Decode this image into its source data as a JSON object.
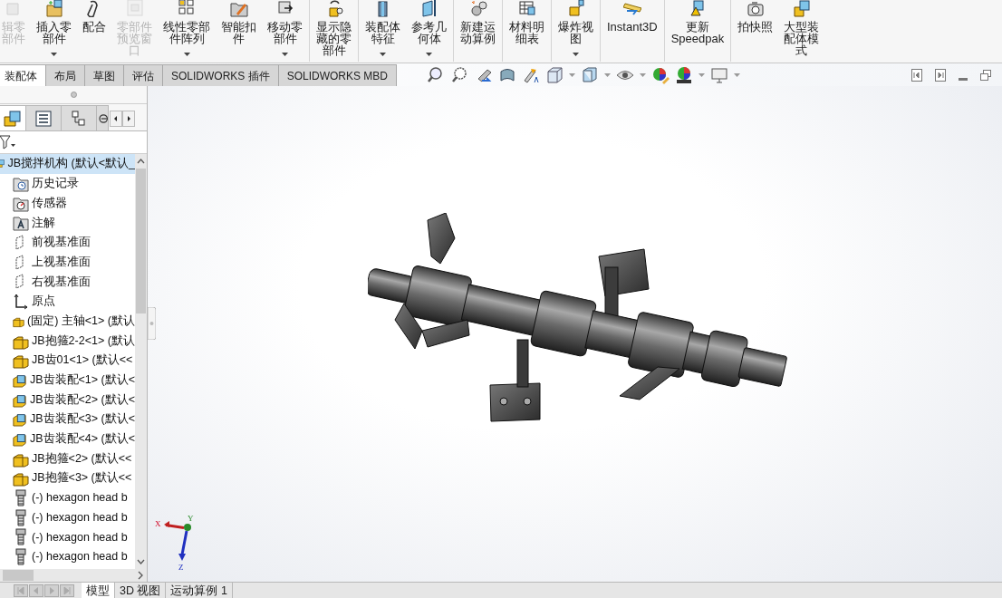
{
  "toolbar": {
    "buttons": [
      {
        "lines": [
          "辑零",
          "部件"
        ],
        "disabled": true,
        "dropdown": false
      },
      {
        "lines": [
          "插入零",
          "部件"
        ],
        "disabled": false,
        "dropdown": true
      },
      {
        "lines": [
          "配合"
        ],
        "disabled": false,
        "dropdown": false
      },
      {
        "lines": [
          "零部件",
          "预览窗",
          "口"
        ],
        "disabled": true,
        "dropdown": false
      },
      {
        "lines": [
          "线性零部",
          "件阵列"
        ],
        "disabled": false,
        "dropdown": true
      },
      {
        "lines": [
          "智能扣",
          "件"
        ],
        "disabled": false,
        "dropdown": false
      },
      {
        "lines": [
          "移动零",
          "部件"
        ],
        "disabled": false,
        "dropdown": true
      },
      {
        "lines": [
          "显示隐",
          "藏的零",
          "部件"
        ],
        "disabled": false,
        "dropdown": false
      },
      {
        "lines": [
          "装配体",
          "特征"
        ],
        "disabled": false,
        "dropdown": true
      },
      {
        "lines": [
          "参考几",
          "何体"
        ],
        "disabled": false,
        "dropdown": true
      },
      {
        "lines": [
          "新建运",
          "动算例"
        ],
        "disabled": false,
        "dropdown": false
      },
      {
        "lines": [
          "材料明",
          "细表"
        ],
        "disabled": false,
        "dropdown": false
      },
      {
        "lines": [
          "爆炸视",
          "图"
        ],
        "disabled": false,
        "dropdown": true
      },
      {
        "lines": [
          "Instant3D"
        ],
        "disabled": false,
        "dropdown": false
      },
      {
        "lines": [
          "更新",
          "Speedpak"
        ],
        "disabled": false,
        "dropdown": false
      },
      {
        "lines": [
          "拍快照"
        ],
        "disabled": false,
        "dropdown": false
      },
      {
        "lines": [
          "大型装",
          "配体模",
          "式"
        ],
        "disabled": false,
        "dropdown": false
      }
    ]
  },
  "command_tabs": [
    {
      "label": "装配体",
      "selected": true
    },
    {
      "label": "布局",
      "selected": false
    },
    {
      "label": "草图",
      "selected": false
    },
    {
      "label": "评估",
      "selected": false
    },
    {
      "label": "SOLIDWORKS 插件",
      "selected": false
    },
    {
      "label": "SOLIDWORKS MBD",
      "selected": false
    }
  ],
  "feature_tree": {
    "root": {
      "label": "JB搅拌机构 (默认<默认_",
      "selected": true,
      "children": [
        {
          "kind": "history",
          "label": "历史记录",
          "selected": false
        },
        {
          "kind": "sensor",
          "label": "传感器",
          "selected": false
        },
        {
          "kind": "annotation",
          "label": "注解",
          "selected": false
        },
        {
          "kind": "plane",
          "label": "前视基准面",
          "selected": false
        },
        {
          "kind": "plane",
          "label": "上视基准面",
          "selected": false
        },
        {
          "kind": "plane",
          "label": "右视基准面",
          "selected": false
        },
        {
          "kind": "origin",
          "label": "原点",
          "selected": false
        },
        {
          "kind": "part",
          "label": "(固定) 主轴<1> (默认",
          "selected": false
        },
        {
          "kind": "part",
          "label": "JB抱箍2-2<1> (默认",
          "selected": false
        },
        {
          "kind": "part",
          "label": "JB齿01<1> (默认<<",
          "selected": false
        },
        {
          "kind": "assembly",
          "label": "JB齿装配<1> (默认<",
          "selected": false
        },
        {
          "kind": "assembly",
          "label": "JB齿装配<2> (默认<",
          "selected": false
        },
        {
          "kind": "assembly",
          "label": "JB齿装配<3> (默认<",
          "selected": false
        },
        {
          "kind": "assembly",
          "label": "JB齿装配<4> (默认<",
          "selected": false
        },
        {
          "kind": "part",
          "label": "JB抱箍<2> (默认<<",
          "selected": false
        },
        {
          "kind": "part",
          "label": "JB抱箍<3> (默认<<",
          "selected": false
        },
        {
          "kind": "bolt",
          "label": "(-) hexagon head b",
          "selected": false
        },
        {
          "kind": "bolt",
          "label": "(-) hexagon head b",
          "selected": false
        },
        {
          "kind": "bolt",
          "label": "(-) hexagon head b",
          "selected": false
        },
        {
          "kind": "bolt",
          "label": "(-) hexagon head b",
          "selected": false
        }
      ]
    }
  },
  "triad": {
    "x_label": "X",
    "y_label": "Y",
    "z_label": "Z"
  },
  "view_tabs": [
    {
      "label": "模型",
      "selected": true
    },
    {
      "label": "3D 视图",
      "selected": false
    },
    {
      "label": "运动算例 1",
      "selected": false
    }
  ]
}
